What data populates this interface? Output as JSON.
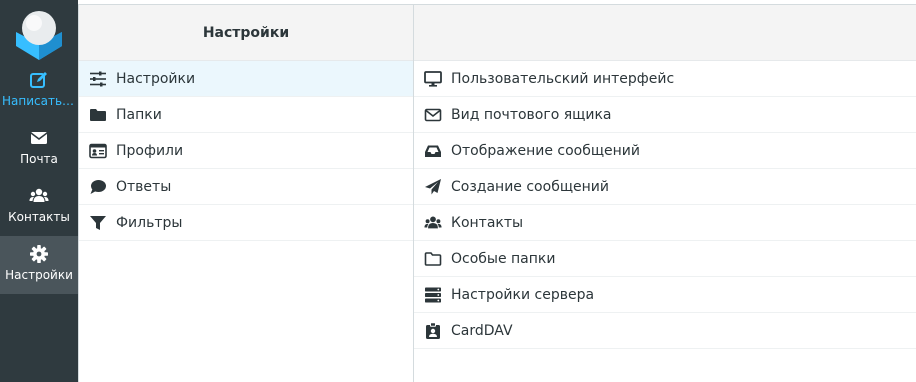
{
  "rail": {
    "items": [
      {
        "label": "Написать сообщение",
        "icon": "pencil-square-icon"
      },
      {
        "label": "Почта",
        "icon": "envelope-icon"
      },
      {
        "label": "Контакты",
        "icon": "users-icon"
      },
      {
        "label": "Настройки",
        "icon": "gear-icon"
      }
    ],
    "active_index": 3
  },
  "middle": {
    "title": "Настройки",
    "items": [
      {
        "label": "Настройки",
        "icon": "sliders-icon"
      },
      {
        "label": "Папки",
        "icon": "folder-icon"
      },
      {
        "label": "Профили",
        "icon": "id-card-icon"
      },
      {
        "label": "Ответы",
        "icon": "speech-bubble-icon"
      },
      {
        "label": "Фильтры",
        "icon": "filter-icon"
      }
    ],
    "selected_index": 0
  },
  "right": {
    "items": [
      {
        "label": "Пользовательский интерфейс",
        "icon": "monitor-icon"
      },
      {
        "label": "Вид почтового ящика",
        "icon": "envelope-outline-icon"
      },
      {
        "label": "Отображение сообщений",
        "icon": "inbox-tray-icon"
      },
      {
        "label": "Создание сообщений",
        "icon": "paper-plane-icon"
      },
      {
        "label": "Контакты",
        "icon": "users-icon"
      },
      {
        "label": "Особые папки",
        "icon": "folder-outline-icon"
      },
      {
        "label": "Настройки сервера",
        "icon": "server-icon"
      },
      {
        "label": "CardDAV",
        "icon": "id-badge-icon"
      }
    ]
  },
  "colors": {
    "rail_bg": "#2f3a3f",
    "rail_active_bg": "#4a555b",
    "accent": "#37beff",
    "selected_row_bg": "#ebf7fd",
    "text": "#2c363a"
  }
}
